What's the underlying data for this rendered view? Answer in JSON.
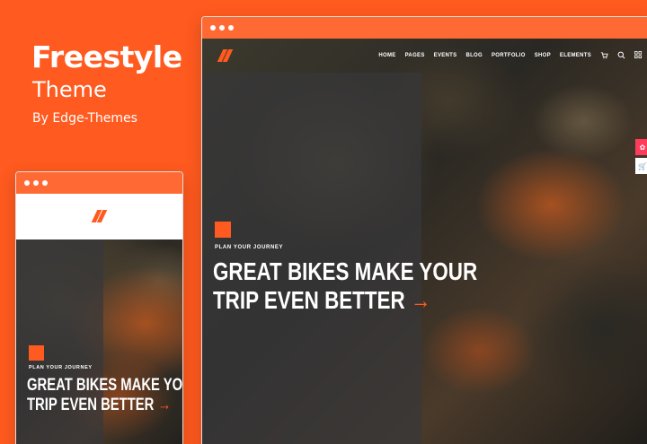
{
  "promo": {
    "title": "Freestyle",
    "subtitle": "Theme",
    "byline": "By Edge-Themes"
  },
  "colors": {
    "accent": "#ff5a1f",
    "titlebar": "#ff6a34"
  },
  "desktop": {
    "nav": {
      "logo_icon": "freestyle-logo-icon",
      "items": [
        {
          "label": "HOME"
        },
        {
          "label": "PAGES"
        },
        {
          "label": "EVENTS"
        },
        {
          "label": "BLOG"
        },
        {
          "label": "PORTFOLIO"
        },
        {
          "label": "SHOP"
        },
        {
          "label": "ELEMENTS"
        }
      ],
      "icons": [
        "cart-icon",
        "search-icon",
        "menu-icon"
      ]
    },
    "hero": {
      "kicker": "PLAN YOUR JOURNEY",
      "headline_line1": "GREAT BIKES MAKE YOUR",
      "headline_line2": "TRIP EVEN BETTER",
      "arrow": "→"
    },
    "side_tabs": [
      "settings-icon",
      "cart-icon"
    ]
  },
  "mobile": {
    "logo_icon": "freestyle-logo-icon",
    "hero": {
      "kicker": "PLAN YOUR JOURNEY",
      "headline_line1": "GREAT BIKES MAKE YOUR",
      "headline_line2": "TRIP EVEN BETTER",
      "arrow": "→"
    }
  }
}
